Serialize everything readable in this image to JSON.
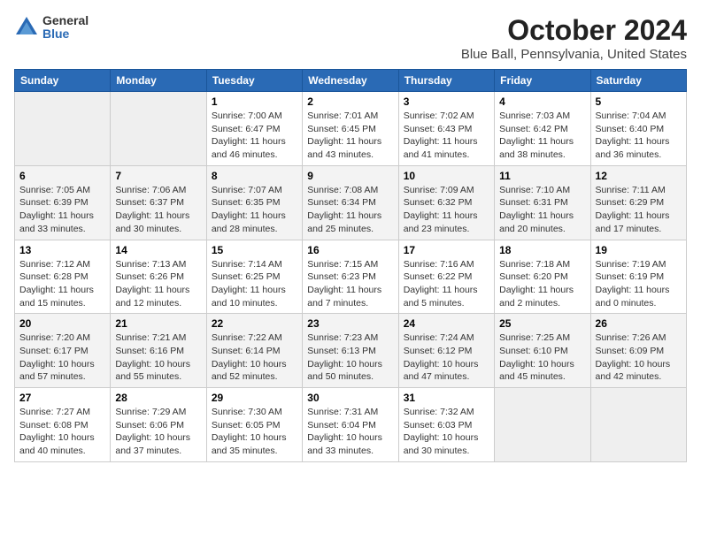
{
  "logo": {
    "general": "General",
    "blue": "Blue"
  },
  "title": "October 2024",
  "location": "Blue Ball, Pennsylvania, United States",
  "days_of_week": [
    "Sunday",
    "Monday",
    "Tuesday",
    "Wednesday",
    "Thursday",
    "Friday",
    "Saturday"
  ],
  "weeks": [
    [
      {
        "day": "",
        "detail": ""
      },
      {
        "day": "",
        "detail": ""
      },
      {
        "day": "1",
        "detail": "Sunrise: 7:00 AM\nSunset: 6:47 PM\nDaylight: 11 hours and 46 minutes."
      },
      {
        "day": "2",
        "detail": "Sunrise: 7:01 AM\nSunset: 6:45 PM\nDaylight: 11 hours and 43 minutes."
      },
      {
        "day": "3",
        "detail": "Sunrise: 7:02 AM\nSunset: 6:43 PM\nDaylight: 11 hours and 41 minutes."
      },
      {
        "day": "4",
        "detail": "Sunrise: 7:03 AM\nSunset: 6:42 PM\nDaylight: 11 hours and 38 minutes."
      },
      {
        "day": "5",
        "detail": "Sunrise: 7:04 AM\nSunset: 6:40 PM\nDaylight: 11 hours and 36 minutes."
      }
    ],
    [
      {
        "day": "6",
        "detail": "Sunrise: 7:05 AM\nSunset: 6:39 PM\nDaylight: 11 hours and 33 minutes."
      },
      {
        "day": "7",
        "detail": "Sunrise: 7:06 AM\nSunset: 6:37 PM\nDaylight: 11 hours and 30 minutes."
      },
      {
        "day": "8",
        "detail": "Sunrise: 7:07 AM\nSunset: 6:35 PM\nDaylight: 11 hours and 28 minutes."
      },
      {
        "day": "9",
        "detail": "Sunrise: 7:08 AM\nSunset: 6:34 PM\nDaylight: 11 hours and 25 minutes."
      },
      {
        "day": "10",
        "detail": "Sunrise: 7:09 AM\nSunset: 6:32 PM\nDaylight: 11 hours and 23 minutes."
      },
      {
        "day": "11",
        "detail": "Sunrise: 7:10 AM\nSunset: 6:31 PM\nDaylight: 11 hours and 20 minutes."
      },
      {
        "day": "12",
        "detail": "Sunrise: 7:11 AM\nSunset: 6:29 PM\nDaylight: 11 hours and 17 minutes."
      }
    ],
    [
      {
        "day": "13",
        "detail": "Sunrise: 7:12 AM\nSunset: 6:28 PM\nDaylight: 11 hours and 15 minutes."
      },
      {
        "day": "14",
        "detail": "Sunrise: 7:13 AM\nSunset: 6:26 PM\nDaylight: 11 hours and 12 minutes."
      },
      {
        "day": "15",
        "detail": "Sunrise: 7:14 AM\nSunset: 6:25 PM\nDaylight: 11 hours and 10 minutes."
      },
      {
        "day": "16",
        "detail": "Sunrise: 7:15 AM\nSunset: 6:23 PM\nDaylight: 11 hours and 7 minutes."
      },
      {
        "day": "17",
        "detail": "Sunrise: 7:16 AM\nSunset: 6:22 PM\nDaylight: 11 hours and 5 minutes."
      },
      {
        "day": "18",
        "detail": "Sunrise: 7:18 AM\nSunset: 6:20 PM\nDaylight: 11 hours and 2 minutes."
      },
      {
        "day": "19",
        "detail": "Sunrise: 7:19 AM\nSunset: 6:19 PM\nDaylight: 11 hours and 0 minutes."
      }
    ],
    [
      {
        "day": "20",
        "detail": "Sunrise: 7:20 AM\nSunset: 6:17 PM\nDaylight: 10 hours and 57 minutes."
      },
      {
        "day": "21",
        "detail": "Sunrise: 7:21 AM\nSunset: 6:16 PM\nDaylight: 10 hours and 55 minutes."
      },
      {
        "day": "22",
        "detail": "Sunrise: 7:22 AM\nSunset: 6:14 PM\nDaylight: 10 hours and 52 minutes."
      },
      {
        "day": "23",
        "detail": "Sunrise: 7:23 AM\nSunset: 6:13 PM\nDaylight: 10 hours and 50 minutes."
      },
      {
        "day": "24",
        "detail": "Sunrise: 7:24 AM\nSunset: 6:12 PM\nDaylight: 10 hours and 47 minutes."
      },
      {
        "day": "25",
        "detail": "Sunrise: 7:25 AM\nSunset: 6:10 PM\nDaylight: 10 hours and 45 minutes."
      },
      {
        "day": "26",
        "detail": "Sunrise: 7:26 AM\nSunset: 6:09 PM\nDaylight: 10 hours and 42 minutes."
      }
    ],
    [
      {
        "day": "27",
        "detail": "Sunrise: 7:27 AM\nSunset: 6:08 PM\nDaylight: 10 hours and 40 minutes."
      },
      {
        "day": "28",
        "detail": "Sunrise: 7:29 AM\nSunset: 6:06 PM\nDaylight: 10 hours and 37 minutes."
      },
      {
        "day": "29",
        "detail": "Sunrise: 7:30 AM\nSunset: 6:05 PM\nDaylight: 10 hours and 35 minutes."
      },
      {
        "day": "30",
        "detail": "Sunrise: 7:31 AM\nSunset: 6:04 PM\nDaylight: 10 hours and 33 minutes."
      },
      {
        "day": "31",
        "detail": "Sunrise: 7:32 AM\nSunset: 6:03 PM\nDaylight: 10 hours and 30 minutes."
      },
      {
        "day": "",
        "detail": ""
      },
      {
        "day": "",
        "detail": ""
      }
    ]
  ]
}
